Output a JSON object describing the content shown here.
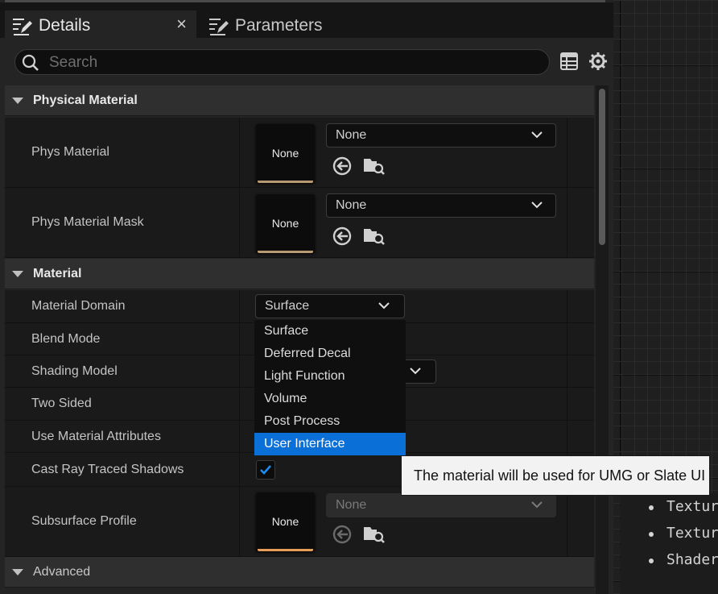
{
  "tabs": {
    "details": {
      "label": "Details",
      "close": "×"
    },
    "parameters": {
      "label": "Parameters"
    }
  },
  "search": {
    "placeholder": "Search",
    "value": ""
  },
  "categories": {
    "physical_material": "Physical Material",
    "material": "Material",
    "advanced": "Advanced"
  },
  "rows": {
    "phys_material": {
      "label": "Phys Material",
      "thumb": "None",
      "combo": "None"
    },
    "phys_material_mask": {
      "label": "Phys Material Mask",
      "thumb": "None",
      "combo": "None"
    },
    "material_domain": {
      "label": "Material Domain",
      "value": "Surface"
    },
    "blend_mode": {
      "label": "Blend Mode"
    },
    "shading_model": {
      "label": "Shading Model"
    },
    "two_sided": {
      "label": "Two Sided"
    },
    "use_material_attributes": {
      "label": "Use Material Attributes"
    },
    "cast_ray_traced_shadows": {
      "label": "Cast Ray Traced Shadows",
      "checked": true
    },
    "subsurface_profile": {
      "label": "Subsurface Profile",
      "thumb": "None",
      "combo": "None"
    }
  },
  "dropdown": {
    "options": [
      "Surface",
      "Deferred Decal",
      "Light Function",
      "Volume",
      "Post Process",
      "User Interface"
    ],
    "selected": "User Interface"
  },
  "tooltip": "The material will be used for UMG or Slate UI",
  "doc_list": [
    "Textur",
    "Textur",
    "Shader"
  ],
  "colors": {
    "accent": "#0a6fd6",
    "thumb_bar": "#b89a72"
  }
}
